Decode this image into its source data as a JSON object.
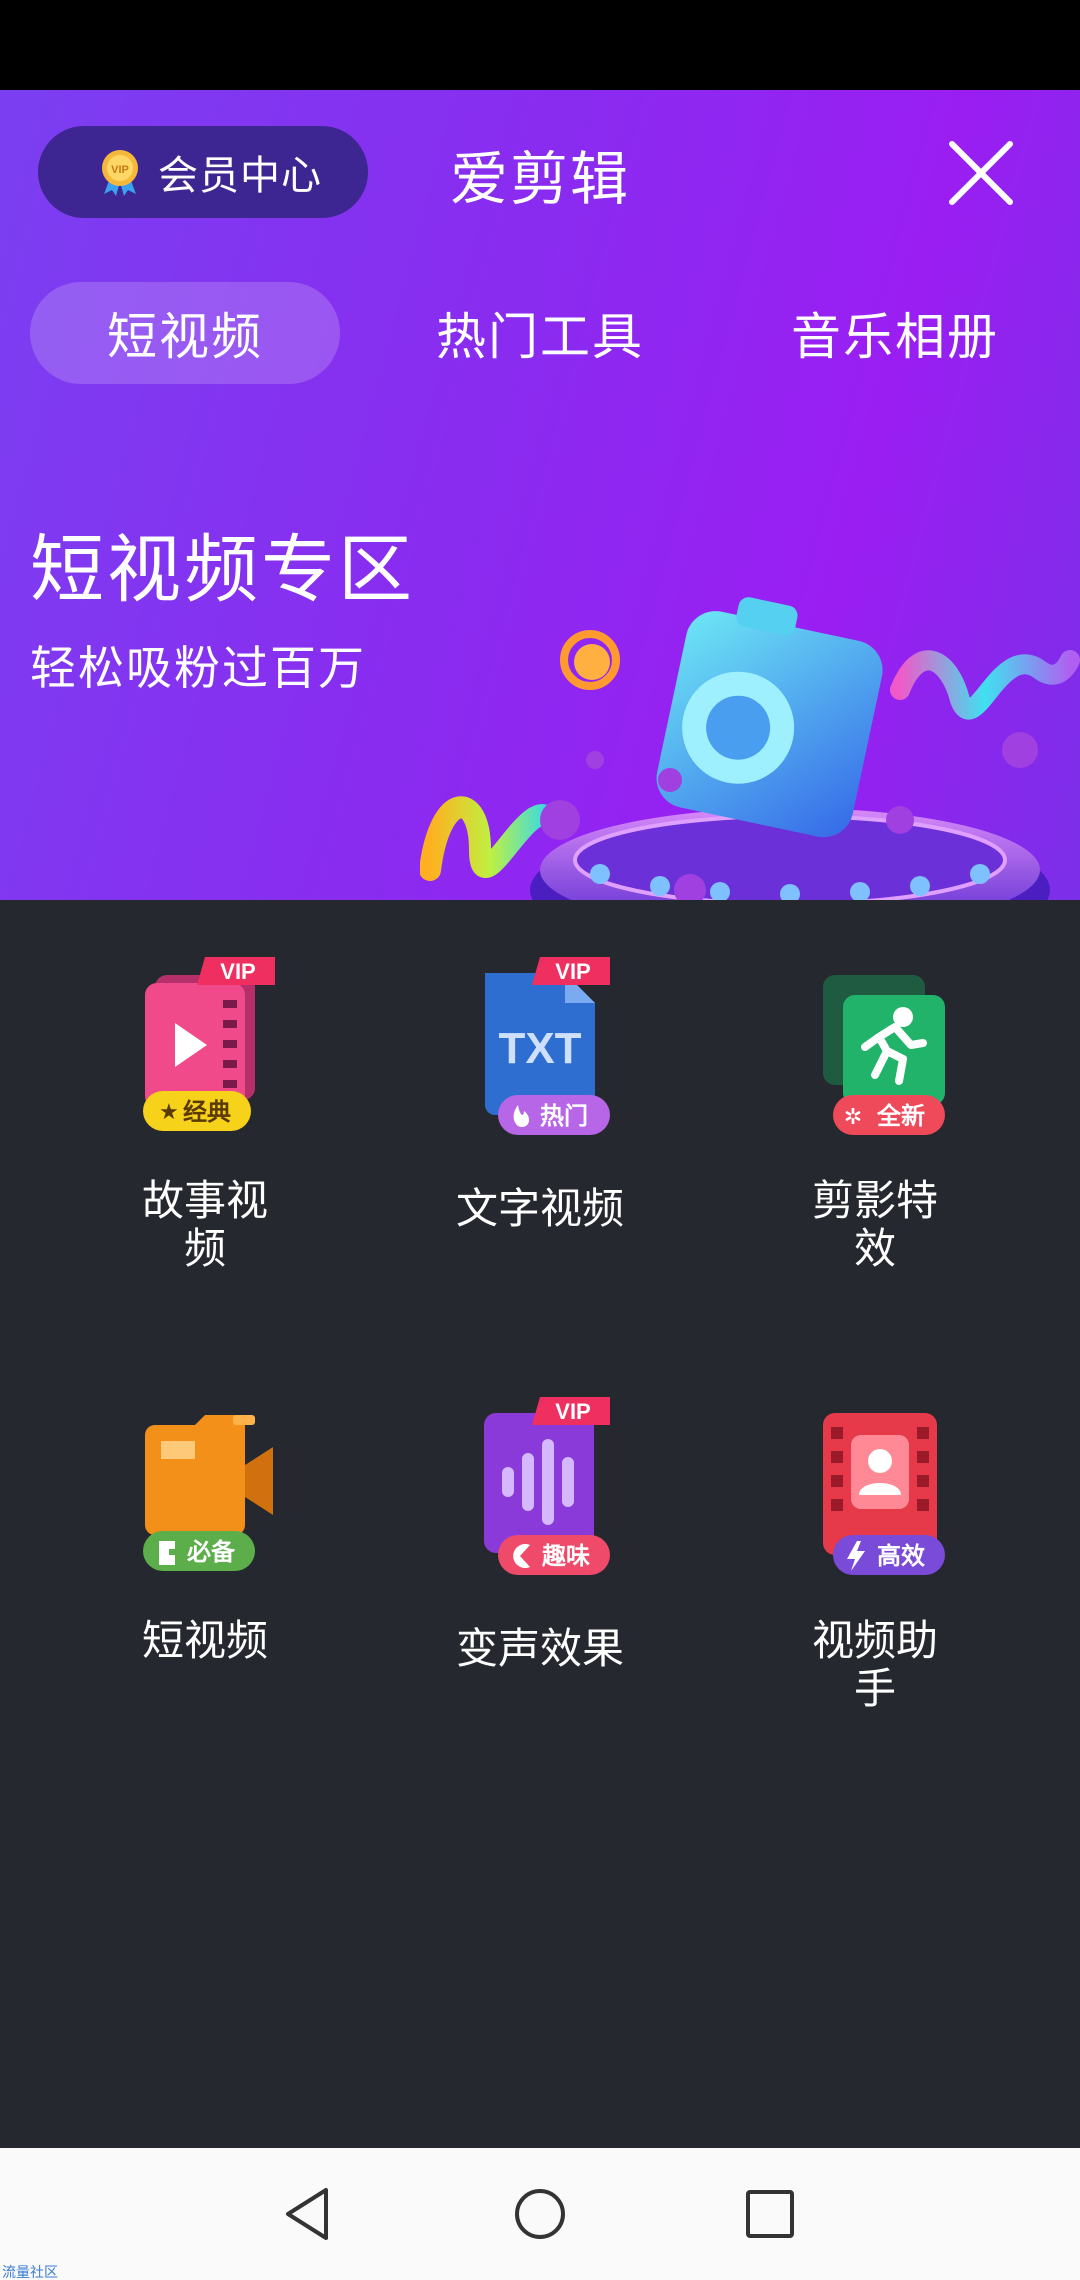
{
  "header": {
    "vip_center_label": "会员中心",
    "app_title": "爱剪辑"
  },
  "tabs": [
    {
      "label": "短视频",
      "active": true
    },
    {
      "label": "热门工具",
      "active": false
    },
    {
      "label": "音乐相册",
      "active": false
    }
  ],
  "banner": {
    "title": "短视频专区",
    "subtitle": "轻松吸粉过百万"
  },
  "tools": [
    {
      "label": "故事视\n频",
      "badge": "经典",
      "vip": "VIP",
      "icon": "story-video-icon"
    },
    {
      "label": "文字视频",
      "badge": "热门",
      "vip": "VIP",
      "icon": "txt-file-icon",
      "icon_text": "TXT"
    },
    {
      "label": "剪影特\n效",
      "badge": "全新",
      "vip": "",
      "icon": "running-person-icon"
    },
    {
      "label": "短视频",
      "badge": "必备",
      "vip": "",
      "icon": "video-camera-icon"
    },
    {
      "label": "变声效果",
      "badge": "趣味",
      "vip": "VIP",
      "icon": "voice-wave-icon"
    },
    {
      "label": "视频助\n手",
      "badge": "高效",
      "vip": "",
      "icon": "film-user-icon"
    }
  ],
  "watermark": "流量社区",
  "colors": {
    "vip_badge": "#ef2f5f",
    "accent_purple": "#8a2bf0",
    "background": "#25282e"
  }
}
